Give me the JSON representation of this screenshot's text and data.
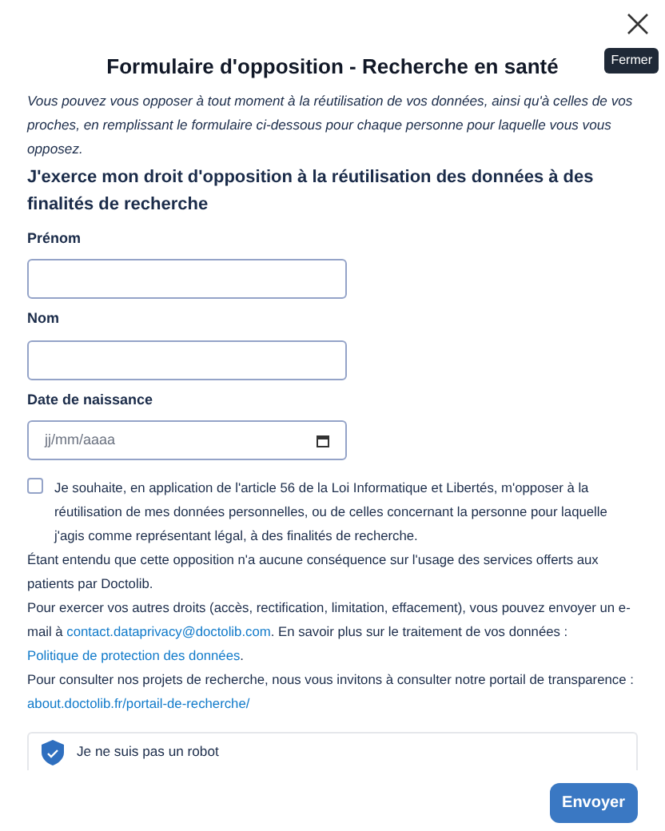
{
  "dialog": {
    "title": "Formulaire d'opposition - Recherche en santé",
    "close_tooltip": "Fermer"
  },
  "intro": "Vous pouvez vous opposer à tout moment à la réutilisation de vos données, ainsi qu'à celles de vos proches, en remplissant le formulaire ci-dessous pour chaque personne pour laquelle vous vous opposez.",
  "heading": "J'exerce mon droit d'opposition à la réutilisation des données à des finalités de recherche",
  "fields": [
    {
      "label": "Prénom",
      "kind": "text"
    },
    {
      "label": "Nom",
      "kind": "text"
    },
    {
      "label": "Date de naissance",
      "kind": "date",
      "placeholder": "jj/mm/aaaa"
    }
  ],
  "consent": {
    "checked": false,
    "text": "Je souhaite, en application de l'article 56 de la Loi Informatique et Libertés, m'opposer à la réutilisation de mes données personnelles, ou de celles concernant la personne pour laquelle j'agis comme représentant légal, à des finalités de recherche."
  },
  "info": [
    [
      {
        "kind": "text",
        "text": "Étant entendu que cette opposition n'a aucune conséquence sur l'usage des services offerts aux patients par Doctolib."
      }
    ],
    [
      {
        "kind": "text",
        "text": "Pour exercer vos autres droits (accès, rectification, limitation, effacement), vous pouvez envoyer un e-mail à "
      },
      {
        "kind": "link",
        "text": "contact.dataprivacy@doctolib.com"
      },
      {
        "kind": "text",
        "text": ". En savoir plus sur le traitement de vos données : "
      },
      {
        "kind": "link",
        "text": "Politique de protection des données"
      },
      {
        "kind": "text",
        "text": "."
      }
    ],
    [
      {
        "kind": "text",
        "text": "Pour consulter nos projets de recherche, nous vous invitons à consulter notre portail de transparence : "
      },
      {
        "kind": "link",
        "text": "about.doctolib.fr/portail-de-recherche/"
      }
    ]
  ],
  "captcha": {
    "label": "Je ne suis pas un robot",
    "verified": true
  },
  "submit": "Envoyer"
}
